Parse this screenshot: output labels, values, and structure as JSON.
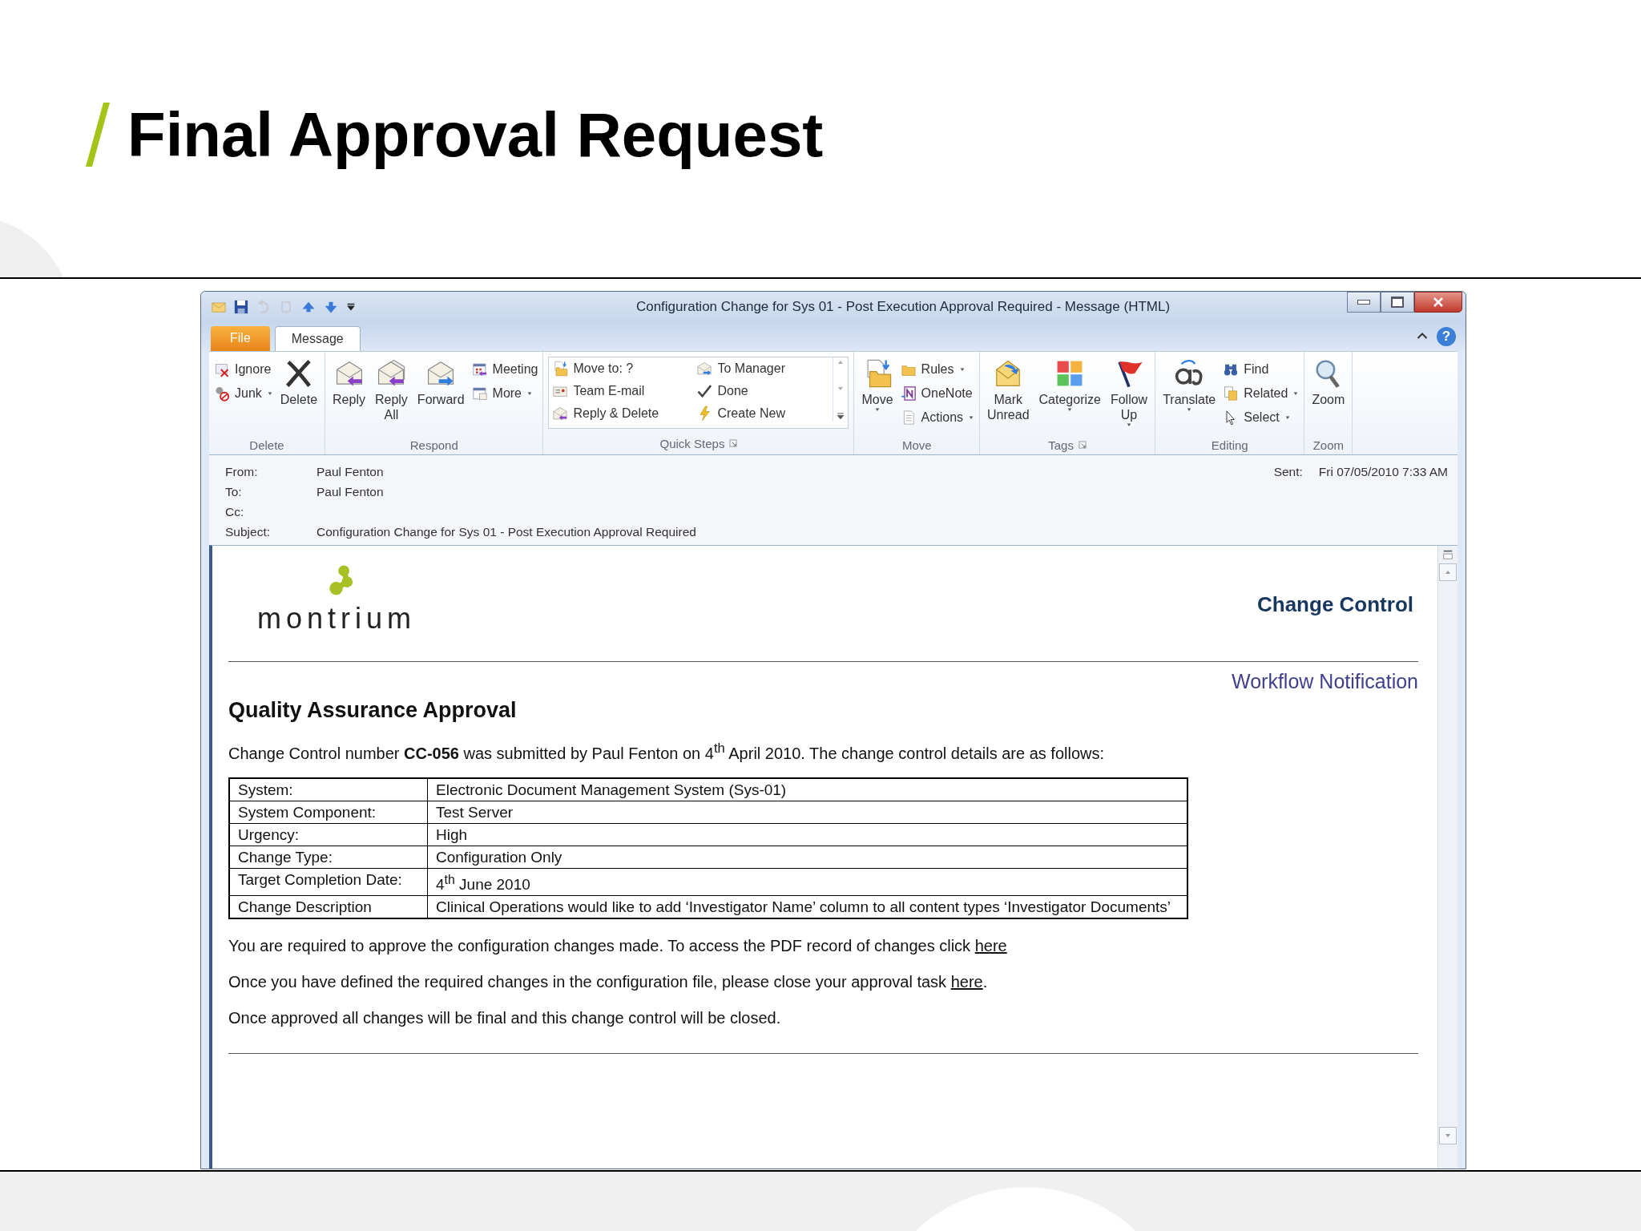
{
  "slide_title": "Final Approval Request",
  "window": {
    "title": "Configuration Change for Sys 01 - Post Execution Approval Required  -  Message (HTML)"
  },
  "tabs": [
    {
      "label": "File",
      "kind": "backstage",
      "selected": false
    },
    {
      "label": "Message",
      "kind": "normal",
      "selected": true
    }
  ],
  "help_button": {
    "label": "?"
  },
  "ribbon": {
    "groups": [
      {
        "label": "Delete",
        "gallery": false,
        "launcher": false,
        "commands": [
          {
            "label": "Ignore",
            "kind": "small",
            "dropdown": false
          },
          {
            "label": "Junk",
            "kind": "small",
            "dropdown": true
          },
          {
            "label": "Delete",
            "kind": "large",
            "dropdown": false
          }
        ]
      },
      {
        "label": "Respond",
        "gallery": false,
        "launcher": false,
        "commands": [
          {
            "label": "Reply",
            "kind": "large",
            "dropdown": false
          },
          {
            "label": "Reply All",
            "kind": "large",
            "dropdown": false
          },
          {
            "label": "Forward",
            "kind": "large",
            "dropdown": false
          },
          {
            "label": "Meeting",
            "kind": "small",
            "dropdown": false
          },
          {
            "label": "More",
            "kind": "small",
            "dropdown": true
          }
        ]
      },
      {
        "label": "Quick Steps",
        "gallery": true,
        "launcher": true,
        "commands": [
          {
            "label": "Move to: ?",
            "kind": "small",
            "dropdown": false
          },
          {
            "label": "Team E-mail",
            "kind": "small",
            "dropdown": false
          },
          {
            "label": "Reply & Delete",
            "kind": "small",
            "dropdown": false
          },
          {
            "label": "To Manager",
            "kind": "small",
            "dropdown": false
          },
          {
            "label": "Done",
            "kind": "small",
            "dropdown": false
          },
          {
            "label": "Create New",
            "kind": "small",
            "dropdown": false
          }
        ]
      },
      {
        "label": "Move",
        "gallery": false,
        "launcher": false,
        "commands": [
          {
            "label": "Move",
            "kind": "large",
            "dropdown": true
          },
          {
            "label": "Rules",
            "kind": "small",
            "dropdown": true
          },
          {
            "label": "OneNote",
            "kind": "small",
            "dropdown": false
          },
          {
            "label": "Actions",
            "kind": "small",
            "dropdown": true
          }
        ]
      },
      {
        "label": "Tags",
        "gallery": false,
        "launcher": true,
        "commands": [
          {
            "label": "Mark Unread",
            "kind": "large",
            "dropdown": false
          },
          {
            "label": "Categorize",
            "kind": "large",
            "dropdown": true
          },
          {
            "label": "Follow Up",
            "kind": "large",
            "dropdown": true
          }
        ]
      },
      {
        "label": "Editing",
        "gallery": false,
        "launcher": false,
        "commands": [
          {
            "label": "Translate",
            "kind": "large",
            "dropdown": true
          },
          {
            "label": "Find",
            "kind": "small",
            "dropdown": false
          },
          {
            "label": "Related",
            "kind": "small",
            "dropdown": true
          },
          {
            "label": "Select",
            "kind": "small",
            "dropdown": true
          }
        ]
      },
      {
        "label": "Zoom",
        "gallery": false,
        "launcher": false,
        "commands": [
          {
            "label": "Zoom",
            "kind": "large",
            "dropdown": false
          }
        ]
      }
    ]
  },
  "header": {
    "fields": [
      {
        "label": "From:",
        "value": "Paul Fenton"
      },
      {
        "label": "To:",
        "value": "Paul Fenton"
      },
      {
        "label": "Cc:"
      },
      {
        "label": "Subject:",
        "value": "Configuration Change for Sys 01 - Post Execution Approval Required"
      }
    ],
    "sent": {
      "label": "Sent:",
      "value": "Fri 07/05/2010 7:33 AM"
    }
  },
  "message": {
    "logo_text": "montrium",
    "banner_title": "Change Control",
    "banner_subtitle": "Workflow Notification",
    "section_title": "Quality Assurance Approval",
    "intro": "Change Control number **CC-056** was submitted by Paul Fenton on 4$^{th}$ April 2010. The change control details are as follows:",
    "details": [
      {
        "label": "System:",
        "value": "Electronic Document Management System (Sys-01)"
      },
      {
        "label": "System Component:",
        "value": "Test Server"
      },
      {
        "label": "Urgency:",
        "value": "High"
      },
      {
        "label": "Change Type:",
        "value": "Configuration Only"
      },
      {
        "label": "Target Completion Date:",
        "value": "4$^{th}$ June 2010"
      },
      {
        "label": "Change Description",
        "value": "Clinical Operations would like to add ‘Investigator Name’ column to all content types ‘Investigator Documents’"
      }
    ],
    "paragraphs": [
      {
        "text": "You are required to approve the configuration changes made. To access the PDF record of changes click ",
        "link": "here"
      },
      {
        "text": "Once you have defined the required changes in the configuration file, please close your approval task ",
        "link": "here",
        "after": "."
      },
      {
        "text": "Once approved all changes will be final and this change control will be closed."
      }
    ]
  }
}
